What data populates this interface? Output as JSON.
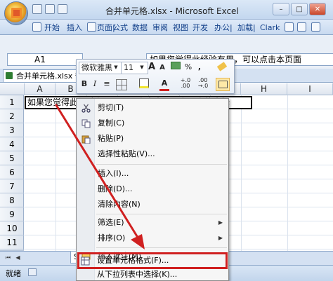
{
  "window": {
    "title": "合并单元格.xlsx - Microsoft Excel",
    "minimize": "–",
    "maximize": "□",
    "close": "✕"
  },
  "ribbon_tabs": [
    "开始",
    "插入",
    "页面|",
    "公式",
    "数据",
    "审阅",
    "视图",
    "开发",
    "办公|",
    "加载|",
    "Clark"
  ],
  "formula_bar": {
    "name_box": "A1",
    "content": "如果您觉得此经验有用，可以点击本页面"
  },
  "workbook_tab": "合并单元格.xlsx *",
  "columns": [
    "A",
    "B",
    "C",
    "D",
    "E",
    "F",
    "G",
    "H",
    "I"
  ],
  "rows": [
    "1",
    "2",
    "3",
    "4",
    "5",
    "6",
    "7",
    "8",
    "9",
    "10",
    "11",
    "12"
  ],
  "cell_a1": "如果您觉得此经验有用，可以点击本页面右上方的大拇",
  "mini_toolbar": {
    "font_name": "微软雅黑",
    "font_size": "11",
    "grow": "A",
    "shrink": "A",
    "percent": "%",
    "comma": ",",
    "bold": "B",
    "italic": "I",
    "align": "≡",
    "font_color_letter": "A",
    "inc_decimal": "+.0",
    "dec_decimal": ".00",
    "inc_decimal_sub": ".00",
    "dec_decimal_sub": "→.0"
  },
  "context_menu": [
    {
      "label": "剪切(T)",
      "icon": "scissors-icon"
    },
    {
      "label": "复制(C)",
      "icon": "copy-icon"
    },
    {
      "label": "粘贴(P)",
      "icon": "paste-icon"
    },
    {
      "label": "选择性粘贴(V)...",
      "icon": ""
    },
    {
      "label": "插入(I)...",
      "icon": ""
    },
    {
      "label": "删除(D)...",
      "icon": ""
    },
    {
      "label": "清除内容(N)",
      "icon": ""
    },
    {
      "label": "筛选(E)",
      "icon": "",
      "submenu": true
    },
    {
      "label": "排序(O)",
      "icon": "",
      "submenu": true
    },
    {
      "label": "插入批注(M)",
      "icon": "comment-icon"
    },
    {
      "label": "设置单元格格式(F)...",
      "icon": "format-cells-icon"
    },
    {
      "label": "从下拉列表中选择(K)...",
      "icon": ""
    }
  ],
  "sheet_tab": "Sheet1",
  "status": "就绪",
  "colors": {
    "accent": "#15428b",
    "highlight_box": "#d02020",
    "arrow": "#d02020"
  }
}
